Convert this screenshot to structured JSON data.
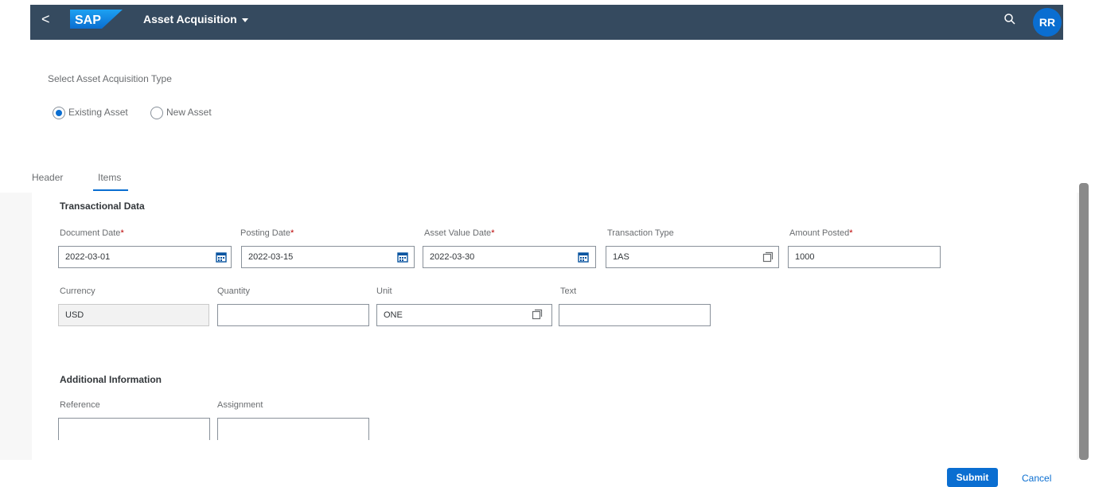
{
  "shell": {
    "back_label": "<",
    "logo_text": "SAP",
    "app_title": "Asset Acquisition",
    "user_initials": "RR"
  },
  "acquisition_type": {
    "label": "Select Asset Acquisition Type",
    "options": [
      {
        "label": "Existing Asset",
        "selected": true
      },
      {
        "label": "New Asset",
        "selected": false
      }
    ]
  },
  "tabs": [
    {
      "label": "Header",
      "selected": false
    },
    {
      "label": "Items",
      "selected": true
    }
  ],
  "transactional": {
    "title": "Transactional Data",
    "fields": {
      "document_date": {
        "label": "Document Date",
        "value": "2022-03-01",
        "required": "*"
      },
      "posting_date": {
        "label": "Posting Date",
        "value": "2022-03-15",
        "required": "*"
      },
      "asset_value_date": {
        "label": "Asset Value Date",
        "value": "2022-03-30",
        "required": "*"
      },
      "transaction_type": {
        "label": "Transaction Type",
        "value": "1AS"
      },
      "amount_posted": {
        "label": "Amount Posted",
        "value": "1000",
        "required": "*"
      },
      "currency": {
        "label": "Currency",
        "value": "USD"
      },
      "quantity": {
        "label": "Quantity",
        "value": ""
      },
      "unit": {
        "label": "Unit",
        "value": "ONE"
      },
      "text": {
        "label": "Text",
        "value": ""
      }
    }
  },
  "additional": {
    "title": "Additional Information",
    "fields": {
      "reference": {
        "label": "Reference",
        "value": ""
      },
      "assignment": {
        "label": "Assignment",
        "value": ""
      }
    }
  },
  "footer": {
    "submit_label": "Submit",
    "cancel_label": "Cancel"
  },
  "colors": {
    "shell_bg": "#354a5f",
    "accent": "#0a6ed1",
    "required": "#bb0000"
  },
  "icons": {
    "back": "chevron-left-icon",
    "search": "search-icon",
    "date": "calendar-icon",
    "value_help": "value-help-icon"
  }
}
